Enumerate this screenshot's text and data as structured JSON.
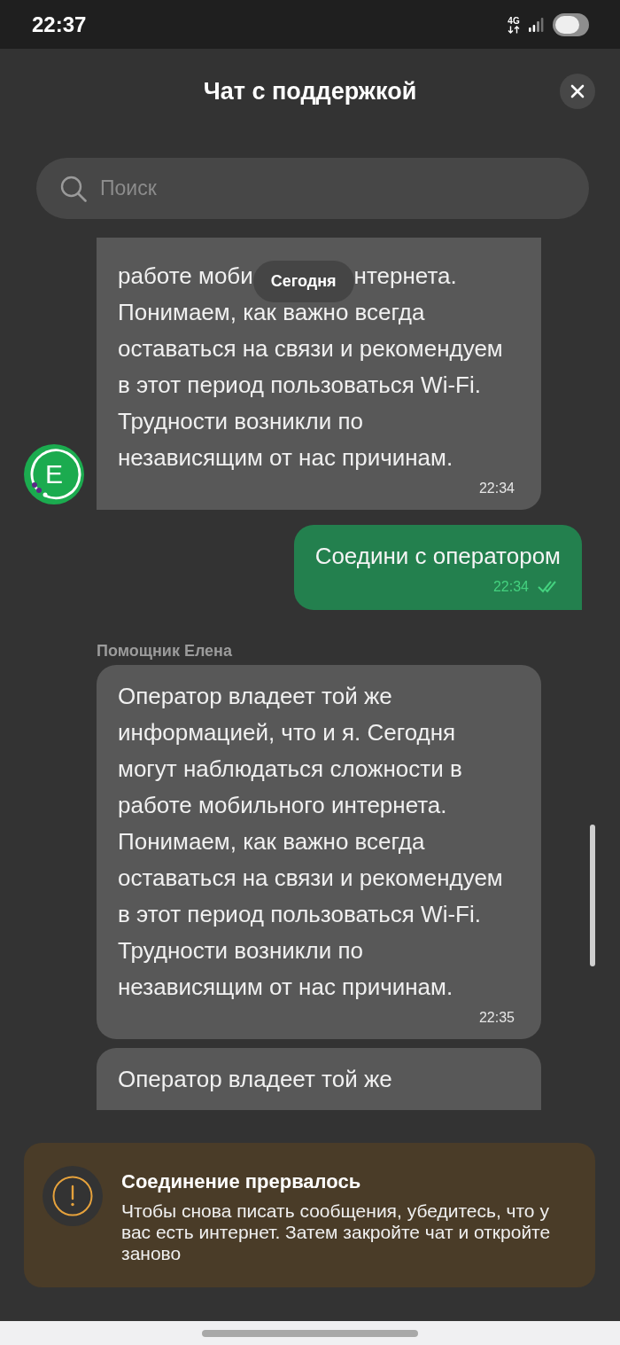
{
  "status_bar": {
    "time": "22:37",
    "network_type": "4G"
  },
  "header": {
    "title": "Чат с поддержкой"
  },
  "search": {
    "placeholder": "Поиск"
  },
  "date_chip": {
    "label": "Сегодня"
  },
  "messages": [
    {
      "kind": "incoming",
      "avatar": "Е",
      "fragments": [
        "работе моби",
        "нтернета."
      ],
      "text": "Понимаем, как важно всегда оставаться на связи и рекомендуем в этот период пользоваться Wi-Fi. Трудности возникли по независящим от нас причинам.",
      "time": "22:34"
    },
    {
      "kind": "outgoing",
      "text": "Соедини с оператором",
      "time": "22:34",
      "read": true
    },
    {
      "kind": "incoming",
      "sender": "Помощник Елена",
      "text": "Оператор владеет той же информацией, что и я. Сегодня могут наблюдаться сложности в работе мобильного интернета. Понимаем, как важно всегда оставаться на связи и рекомендуем в этот период пользоваться Wi-Fi. Трудности возникли по независящим от нас причинам.",
      "time": "22:35"
    },
    {
      "kind": "incoming",
      "text": "Оператор владеет той же"
    }
  ],
  "banner": {
    "title": "Соединение прервалось",
    "text": "Чтобы снова писать сообщения, убедитесь, что у вас есть интернет. Затем закройте чат и откройте заново"
  }
}
